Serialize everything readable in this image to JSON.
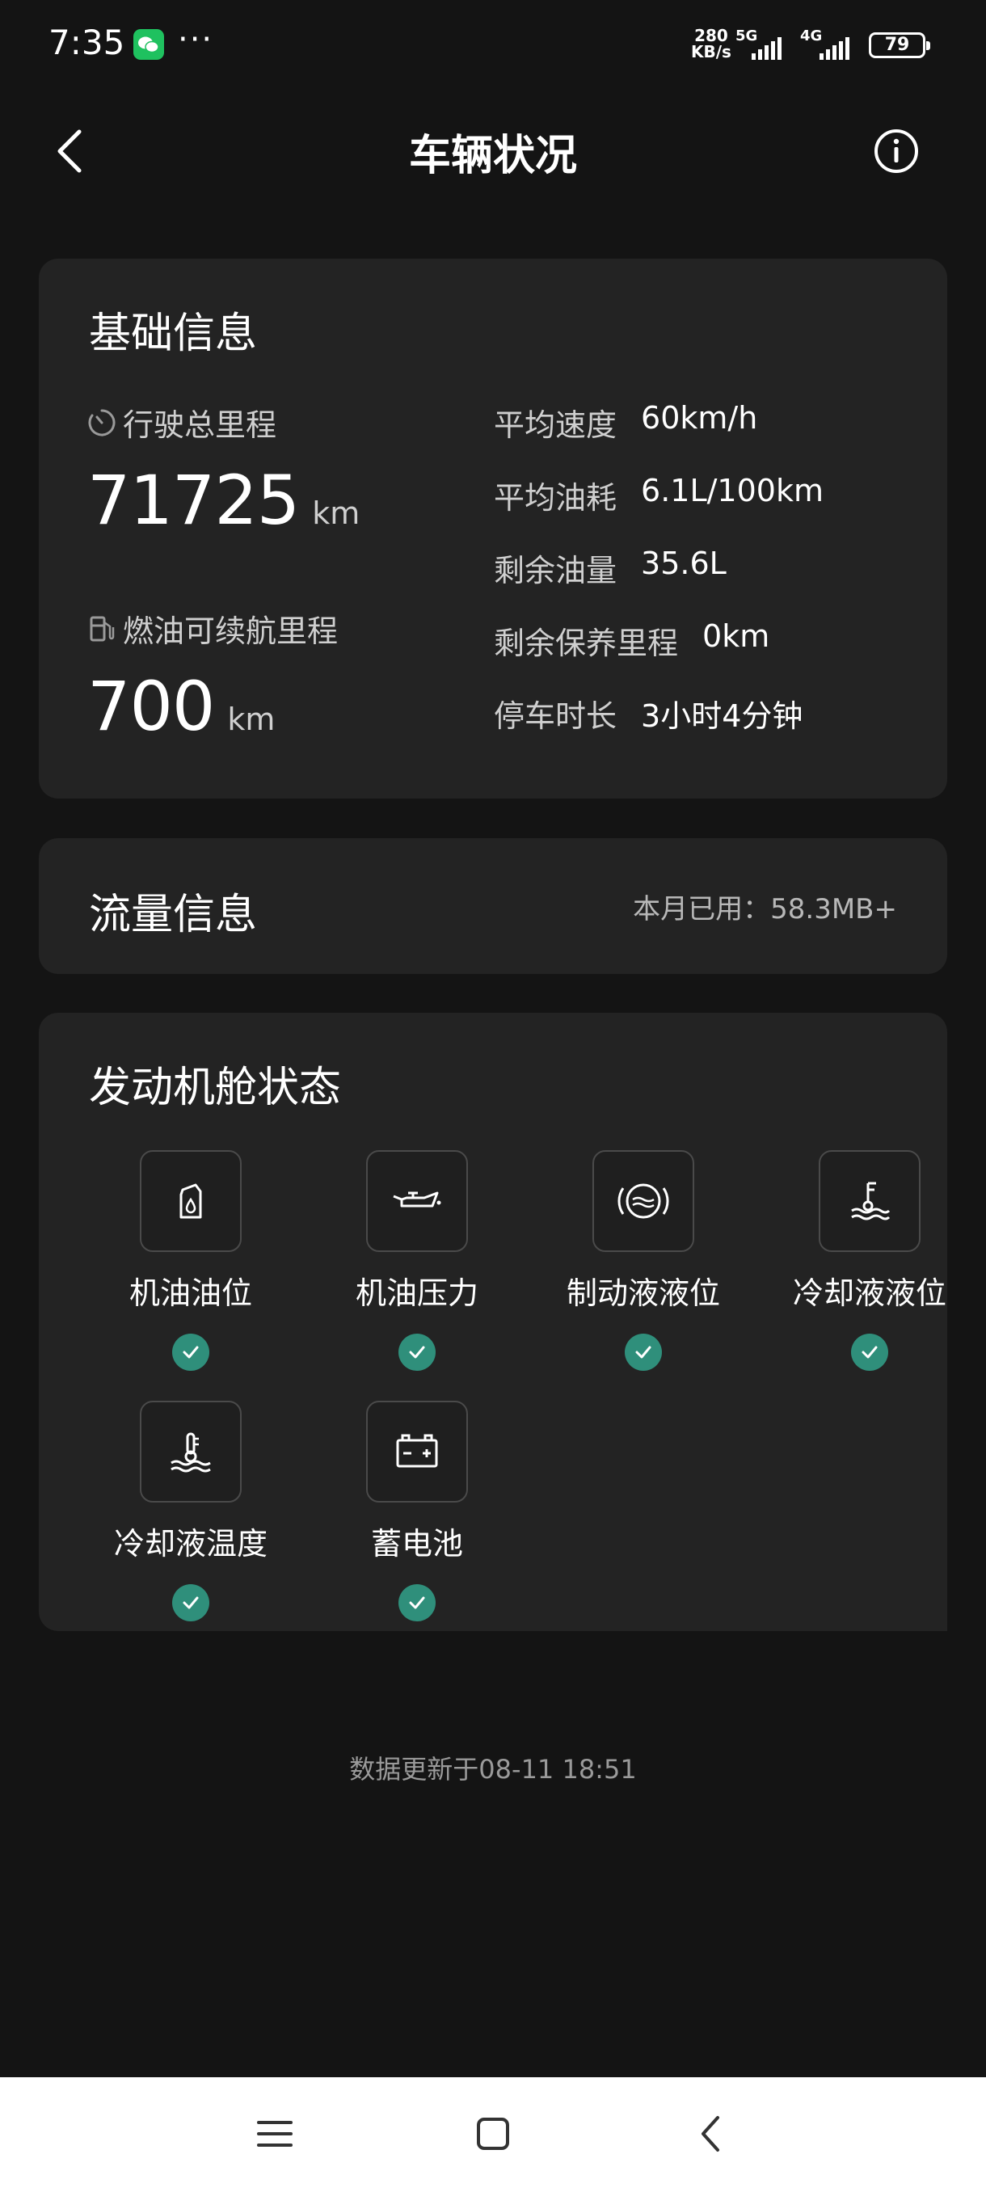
{
  "status_bar": {
    "time": "7:35",
    "more": "···",
    "speed_value": "280",
    "speed_unit": "KB/s",
    "sig1_label": "5G",
    "sig2_label": "4G",
    "battery": "79",
    "icons": [
      "wechat-icon",
      "signal-icon",
      "battery-icon"
    ]
  },
  "nav": {
    "title": "车辆状况"
  },
  "basic_info": {
    "title": "基础信息",
    "mileage_label": "行驶总里程",
    "mileage_value": "71725",
    "mileage_unit": "km",
    "range_label": "燃油可续航里程",
    "range_value": "700",
    "range_unit": "km",
    "details": [
      {
        "key": "平均速度",
        "value": "60km/h"
      },
      {
        "key": "平均油耗",
        "value": "6.1L/100km"
      },
      {
        "key": "剩余油量",
        "value": "35.6L"
      },
      {
        "key": "剩余保养里程",
        "value": "0km"
      },
      {
        "key": "停车时长",
        "value": "3小时4分钟"
      }
    ]
  },
  "traffic": {
    "title": "流量信息",
    "usage": "本月已用：58.3MB+"
  },
  "engine": {
    "title": "发动机舱状态",
    "items": [
      {
        "label": "机油油位",
        "icon": "oil-level-icon",
        "status": "ok"
      },
      {
        "label": "机油压力",
        "icon": "oil-pressure-icon",
        "status": "ok"
      },
      {
        "label": "制动液液位",
        "icon": "brake-fluid-icon",
        "status": "ok"
      },
      {
        "label": "冷却液液位",
        "icon": "coolant-level-icon",
        "status": "ok"
      },
      {
        "label": "冷却液温度",
        "icon": "coolant-temp-icon",
        "status": "ok"
      },
      {
        "label": "蓄电池",
        "icon": "battery-icon",
        "status": "ok"
      }
    ]
  },
  "footer": {
    "updated": "数据更新于08-11 18:51"
  },
  "colors": {
    "background": "#141414",
    "card": "#232323",
    "ok_green": "#2f8f7b"
  }
}
